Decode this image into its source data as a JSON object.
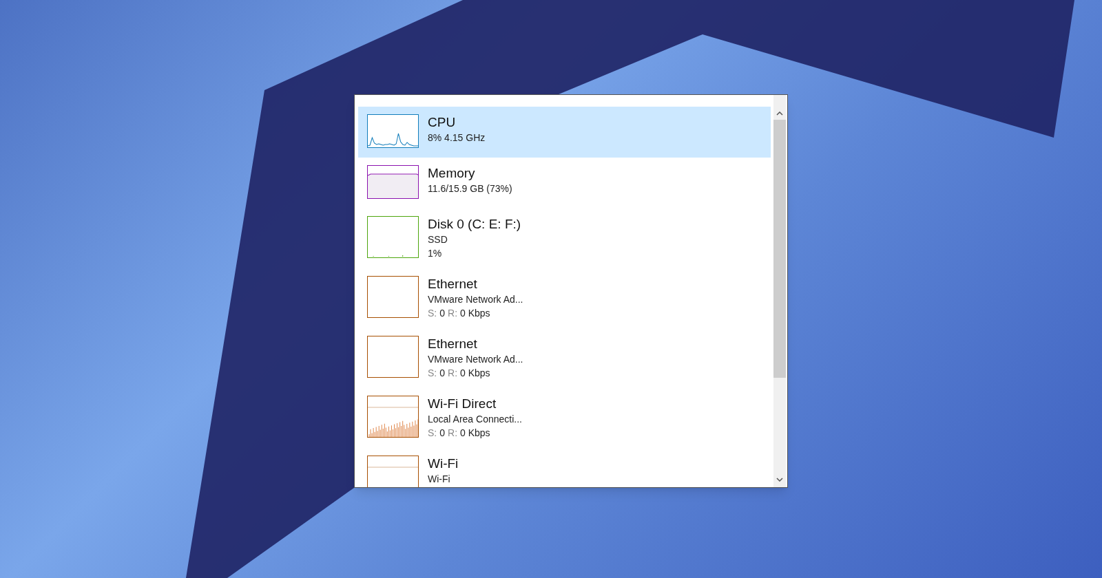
{
  "items": [
    {
      "kind": "cpu",
      "name": "CPU",
      "details": [
        "8% 4.15 GHz"
      ],
      "color": "#117dbb",
      "selected": true
    },
    {
      "kind": "memory",
      "name": "Memory",
      "details": [
        "11.6/15.9 GB (73%)"
      ],
      "color": "#8b12ae",
      "selected": false
    },
    {
      "kind": "disk",
      "name": "Disk 0 (C: E: F:)",
      "details": [
        "SSD",
        "1%"
      ],
      "color": "#4da60c",
      "selected": false
    },
    {
      "kind": "network",
      "name": "Ethernet",
      "details": [
        "VMware Network Ad..."
      ],
      "rate": {
        "s_label": "S:",
        "s_value": "0",
        "r_label": "R:",
        "r_value": "0 Kbps"
      },
      "color": "#a74f01",
      "selected": false
    },
    {
      "kind": "network",
      "name": "Ethernet",
      "details": [
        "VMware Network Ad..."
      ],
      "rate": {
        "s_label": "S:",
        "s_value": "0",
        "r_label": "R:",
        "r_value": "0 Kbps"
      },
      "color": "#a74f01",
      "selected": false
    },
    {
      "kind": "wifi_direct",
      "name": "Wi-Fi Direct",
      "details": [
        "Local Area Connecti..."
      ],
      "rate": {
        "s_label": "S:",
        "s_value": "0",
        "r_label": "R:",
        "r_value": "0 Kbps"
      },
      "color": "#a74f01",
      "selected": false
    },
    {
      "kind": "wifi",
      "name": "Wi-Fi",
      "details": [
        "Wi-Fi"
      ],
      "color": "#a74f01",
      "selected": false
    }
  ]
}
